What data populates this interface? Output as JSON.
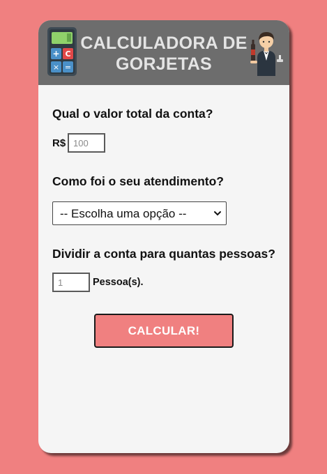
{
  "colors": {
    "page_background": "#f08080",
    "card_background": "#f5f5f5",
    "header_background": "#6d6d6d",
    "header_text": "#e4e4e4",
    "button_background": "#f08080",
    "button_text": "#ffffff"
  },
  "header": {
    "title": "CALCULADORA DE GORJETAS",
    "left_icon": "calculator-icon",
    "right_icon": "waiter-icon"
  },
  "form": {
    "bill": {
      "label": "Qual o valor total da conta?",
      "currency": "R$",
      "placeholder": "100",
      "value": ""
    },
    "service": {
      "label": "Como foi o seu atendimento?",
      "selected_option": "-- Escolha uma opção --"
    },
    "people": {
      "label": "Dividir a conta para quantas pessoas?",
      "placeholder": "1",
      "value": "",
      "suffix": "Pessoa(s)."
    },
    "submit_label": "CALCULAR!"
  }
}
